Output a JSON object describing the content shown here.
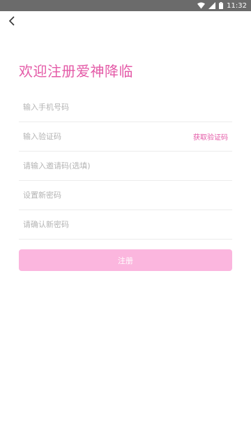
{
  "status_bar": {
    "time": "11:32",
    "icons": [
      "wifi-icon",
      "signal-icon",
      "battery-icon"
    ]
  },
  "header": {
    "back_icon": "chevron-left-icon"
  },
  "page": {
    "title": "欢迎注册爱神降临"
  },
  "form": {
    "phone_placeholder": "输入手机号码",
    "code_placeholder": "输入验证码",
    "get_code_label": "获取验证码",
    "invite_placeholder": "请输入邀请码(选填)",
    "password_placeholder": "设置新密码",
    "confirm_password_placeholder": "请确认新密码",
    "submit_label": "注册"
  },
  "colors": {
    "accent": "#e45aa7",
    "button_bg": "#fbb6de",
    "status_bar_bg": "#6b6b6b"
  }
}
